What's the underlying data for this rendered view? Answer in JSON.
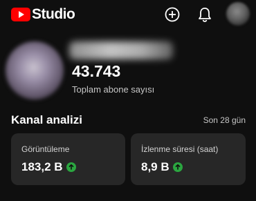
{
  "app": {
    "logo_text": "Studio",
    "logo_color": "#ff0000",
    "header_icons": [
      "create-icon",
      "notifications-bell-icon"
    ]
  },
  "channel": {
    "subscriber_count": "43.743",
    "subscriber_label": "Toplam abone sayısı"
  },
  "analytics": {
    "title": "Kanal analizi",
    "period": "Son 28 gün",
    "cards": [
      {
        "label": "Görüntüleme",
        "value": "183,2 B",
        "trend": "up",
        "trend_color": "#2ba640"
      },
      {
        "label": "İzlenme süresi (saat)",
        "value": "8,9 B",
        "trend": "up",
        "trend_color": "#2ba640"
      }
    ]
  }
}
